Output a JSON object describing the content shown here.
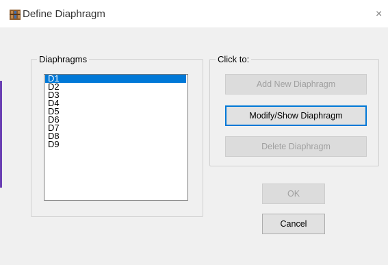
{
  "window": {
    "title": "Define Diaphragm",
    "app_icon": "etabs-app-icon",
    "close_glyph": "×"
  },
  "diaphragms": {
    "label": "Diaphragms",
    "items": [
      "D1",
      "D2",
      "D3",
      "D4",
      "D5",
      "D6",
      "D7",
      "D8",
      "D9"
    ],
    "selected": "D1"
  },
  "click_to": {
    "label": "Click to:",
    "add_label": "Add New Diaphragm",
    "modify_label": "Modify/Show Diaphragm",
    "delete_label": "Delete Diaphragm"
  },
  "buttons": {
    "ok_label": "OK",
    "cancel_label": "Cancel"
  },
  "colors": {
    "selection": "#0078d7",
    "accent_strip": "#6a3fb3"
  }
}
